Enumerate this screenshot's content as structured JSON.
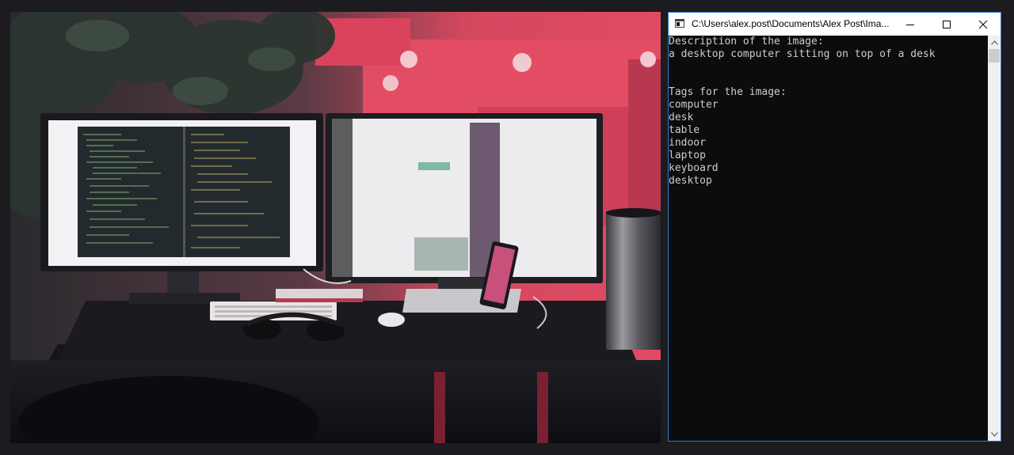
{
  "window": {
    "title": "C:\\Users\\alex.post\\Documents\\Alex Post\\Ima...",
    "icon": "console-app-icon",
    "controls": {
      "minimize": "minimize-icon",
      "maximize": "maximize-icon",
      "close": "close-icon"
    }
  },
  "console": {
    "lines": [
      "Description of the image:",
      "a desktop computer sitting on top of a desk",
      "",
      "",
      "Tags for the image:",
      "computer",
      "desk",
      "table",
      "indoor",
      "laptop",
      "keyboard",
      "desktop"
    ]
  },
  "photo": {
    "subject": "desk-with-dual-monitors-photo"
  },
  "colors": {
    "console_bg": "#0c0c0c",
    "console_text": "#cccccc",
    "window_border": "#2f7ad1",
    "desktop_bg": "#1c1b1f"
  }
}
